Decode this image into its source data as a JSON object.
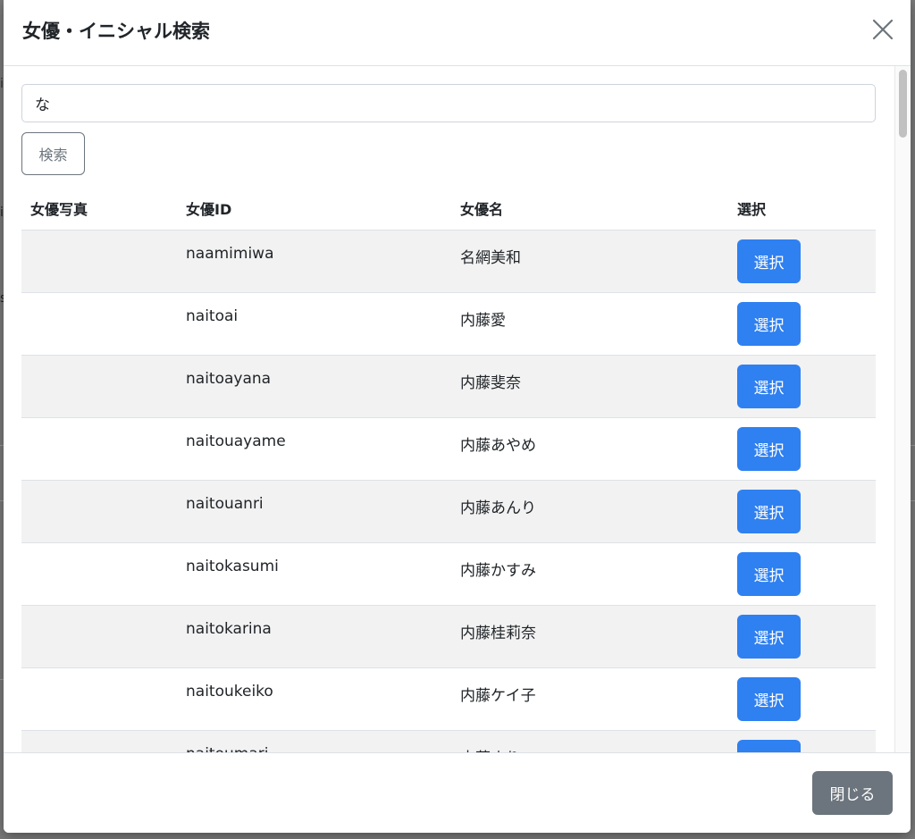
{
  "modal": {
    "title": "女優・イニシャル検索",
    "close_icon": "close-icon"
  },
  "search": {
    "value": "な",
    "button_label": "検索"
  },
  "table": {
    "headers": {
      "photo": "女優写真",
      "id": "女優ID",
      "name": "女優名",
      "select": "選択"
    },
    "rows": [
      {
        "id": "naamimiwa",
        "name": "名網美和",
        "button": "選択"
      },
      {
        "id": "naitoai",
        "name": "内藤愛",
        "button": "選択"
      },
      {
        "id": "naitoayana",
        "name": "内藤斐奈",
        "button": "選択"
      },
      {
        "id": "naitouayame",
        "name": "内藤あやめ",
        "button": "選択"
      },
      {
        "id": "naitouanri",
        "name": "内藤あんり",
        "button": "選択"
      },
      {
        "id": "naitokasumi",
        "name": "内藤かすみ",
        "button": "選択"
      },
      {
        "id": "naitokarina",
        "name": "内藤桂莉奈",
        "button": "選択"
      },
      {
        "id": "naitoukeiko",
        "name": "内藤ケイ子",
        "button": "選択"
      },
      {
        "id": "naitoumari",
        "name": "内藤まり",
        "button": "選択"
      }
    ]
  },
  "footer": {
    "close_label": "閉じる"
  },
  "colors": {
    "primary": "#2f80f0",
    "secondary": "#6c757d",
    "stripe": "#f2f2f2"
  }
}
